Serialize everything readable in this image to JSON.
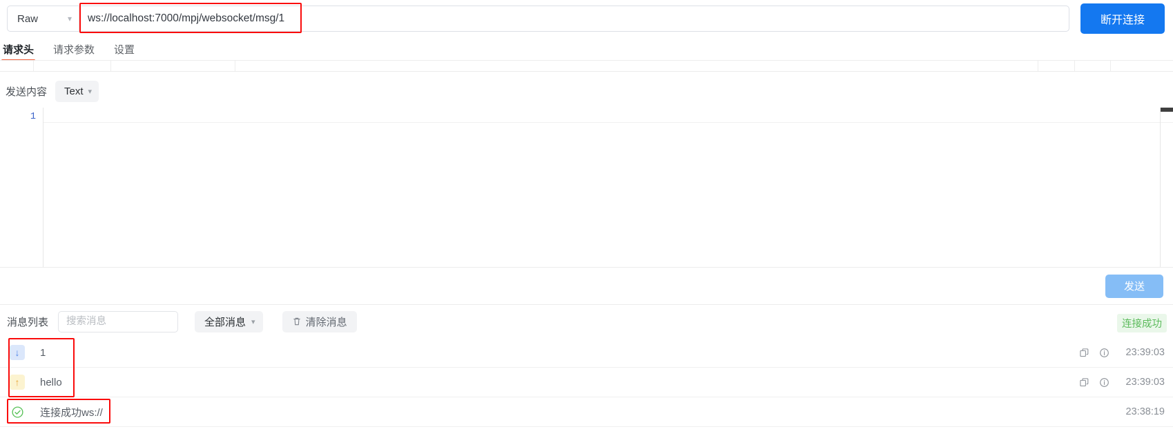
{
  "urlbar": {
    "method": "Raw",
    "method_caret": "chevron-down",
    "url_value": "ws://localhost:7000/mpj/websocket/msg/1",
    "url_placeholder": "ws://",
    "disconnect_label": "断开连接"
  },
  "tabs": [
    {
      "label": "请求头",
      "active": true
    },
    {
      "label": "请求参数",
      "active": false
    },
    {
      "label": "设置",
      "active": false
    }
  ],
  "send_section": {
    "label": "发送内容",
    "type_value": "Text",
    "editor_line_numbers": [
      "1"
    ],
    "editor_value": "",
    "send_label": "发送"
  },
  "message_toolbar": {
    "list_label": "消息列表",
    "search_placeholder": "搜索消息",
    "search_value": "",
    "filter_value": "全部消息",
    "clear_label": "清除消息",
    "clear_icon": "trash-icon",
    "status_text": "连接成功"
  },
  "messages": [
    {
      "direction": "down",
      "direction_icon": "arrow-down-icon",
      "text": "1",
      "copy_icon": "copy-icon",
      "info_icon": "info-icon",
      "time": "23:39:03",
      "has_actions": true
    },
    {
      "direction": "up",
      "direction_icon": "arrow-up-icon",
      "text": "hello",
      "copy_icon": "copy-icon",
      "info_icon": "info-icon",
      "time": "23:39:03",
      "has_actions": true
    },
    {
      "direction": "ok",
      "direction_icon": "check-circle-icon",
      "text": "连接成功ws://",
      "copy_icon": "",
      "info_icon": "",
      "time": "23:38:19",
      "has_actions": false
    }
  ],
  "colors": {
    "accent_blue": "#1478f0",
    "tab_underline": "#f1603c",
    "send_button": "#85bdf6",
    "success_green": "#5cbb5c",
    "annotation_red": "#fa0a0a",
    "received_icon": "#4f86e8",
    "sent_icon": "#e8a83a"
  }
}
